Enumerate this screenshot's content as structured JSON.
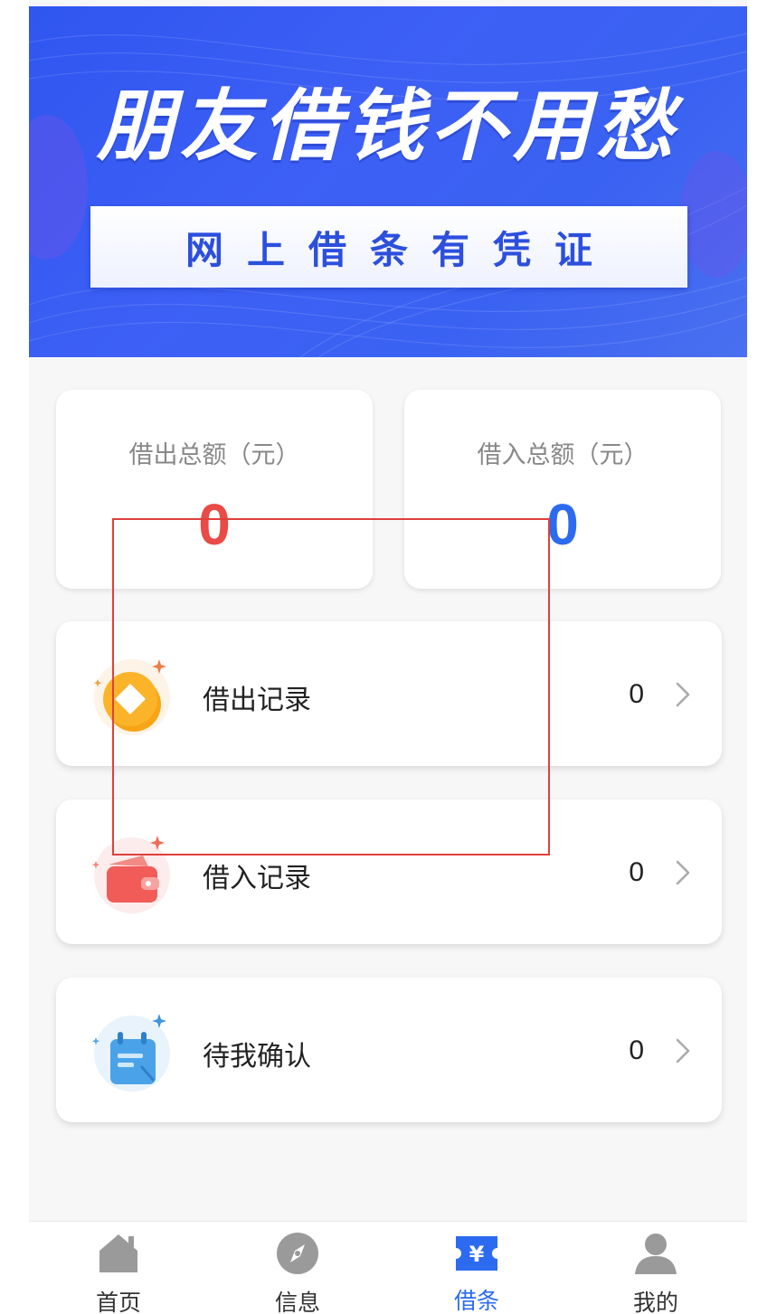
{
  "banner": {
    "title": "朋友借钱不用愁",
    "subtitle": "网上借条有凭证"
  },
  "summary": {
    "lent_label": "借出总额（元）",
    "lent_value": "0",
    "borrowed_label": "借入总额（元）",
    "borrowed_value": "0"
  },
  "records": [
    {
      "label": "借出记录",
      "count": "0",
      "icon": "coin-icon"
    },
    {
      "label": "借入记录",
      "count": "0",
      "icon": "wallet-icon"
    },
    {
      "label": "待我确认",
      "count": "0",
      "icon": "calendar-icon"
    }
  ],
  "tabs": [
    {
      "label": "首页",
      "icon": "home-icon",
      "active": false
    },
    {
      "label": "信息",
      "icon": "compass-icon",
      "active": false
    },
    {
      "label": "借条",
      "icon": "yen-ticket-icon",
      "active": true
    },
    {
      "label": "我的",
      "icon": "user-icon",
      "active": false
    }
  ],
  "colors": {
    "primary": "#2c6bef",
    "banner": "#3a5ff3",
    "lent_red": "#e94b46",
    "annotation": "#e0403c"
  }
}
